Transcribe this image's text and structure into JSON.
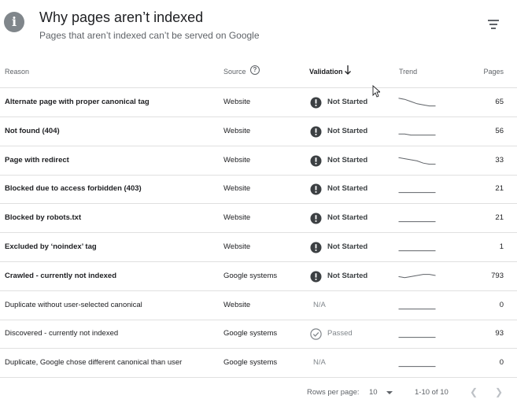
{
  "header": {
    "title": "Why pages aren’t indexed",
    "subtitle": "Pages that aren’t indexed can’t be served on Google"
  },
  "columns": {
    "reason": "Reason",
    "source": "Source",
    "validation": "Validation",
    "trend": "Trend",
    "pages": "Pages"
  },
  "rows": [
    {
      "reason": "Alternate page with proper canonical tag",
      "source": "Website",
      "validation": "Not Started",
      "status": "not-started",
      "pages": "65",
      "bold": true,
      "trend": [
        8,
        7,
        5,
        3,
        2,
        1,
        1
      ]
    },
    {
      "reason": "Not found (404)",
      "source": "Website",
      "validation": "Not Started",
      "status": "not-started",
      "pages": "56",
      "bold": true,
      "trend": [
        2,
        2,
        1,
        1,
        1,
        1,
        1
      ]
    },
    {
      "reason": "Page with redirect",
      "source": "Website",
      "validation": "Not Started",
      "status": "not-started",
      "pages": "33",
      "bold": true,
      "trend": [
        7,
        6,
        5,
        4,
        2,
        1,
        1
      ]
    },
    {
      "reason": "Blocked due to access forbidden (403)",
      "source": "Website",
      "validation": "Not Started",
      "status": "not-started",
      "pages": "21",
      "bold": true,
      "trend": [
        1,
        1,
        1,
        1,
        1,
        1,
        1
      ]
    },
    {
      "reason": "Blocked by robots.txt",
      "source": "Website",
      "validation": "Not Started",
      "status": "not-started",
      "pages": "21",
      "bold": true,
      "trend": [
        1,
        1,
        1,
        1,
        1,
        1,
        1
      ]
    },
    {
      "reason": "Excluded by ‘noindex’ tag",
      "source": "Website",
      "validation": "Not Started",
      "status": "not-started",
      "pages": "1",
      "bold": true,
      "trend": [
        1,
        1,
        1,
        1,
        1,
        1,
        1
      ]
    },
    {
      "reason": "Crawled - currently not indexed",
      "source": "Google systems",
      "validation": "Not Started",
      "status": "not-started",
      "pages": "793",
      "bold": true,
      "trend": [
        4,
        3,
        4,
        5,
        6,
        6,
        5
      ]
    },
    {
      "reason": "Duplicate without user-selected canonical",
      "source": "Website",
      "validation": "N/A",
      "status": "na",
      "pages": "0",
      "bold": false,
      "trend": [
        1,
        1,
        1,
        1,
        1,
        1,
        1
      ]
    },
    {
      "reason": "Discovered - currently not indexed",
      "source": "Google systems",
      "validation": "Passed",
      "status": "passed",
      "pages": "93",
      "bold": false,
      "trend": [
        1,
        1,
        1,
        1,
        1,
        1,
        1
      ]
    },
    {
      "reason": "Duplicate, Google chose different canonical than user",
      "source": "Google systems",
      "validation": "N/A",
      "status": "na",
      "pages": "0",
      "bold": false,
      "trend": [
        1,
        1,
        1,
        1,
        1,
        1,
        1
      ]
    }
  ],
  "pagination": {
    "rows_label": "Rows per page:",
    "rows_value": "10",
    "range": "1-10 of 10"
  },
  "icons": {
    "header": "info-icon",
    "filter": "filter-icon",
    "source_help": "help-icon",
    "sort": "arrow-down-icon",
    "not_started": "exclamation-circle-icon",
    "passed": "check-circle-icon",
    "prev": "chevron-left-icon",
    "next": "chevron-right-icon"
  },
  "colors": {
    "status_icon": "#3c4043",
    "trend_line": "#5f6368",
    "divider": "#e0e0e0"
  }
}
